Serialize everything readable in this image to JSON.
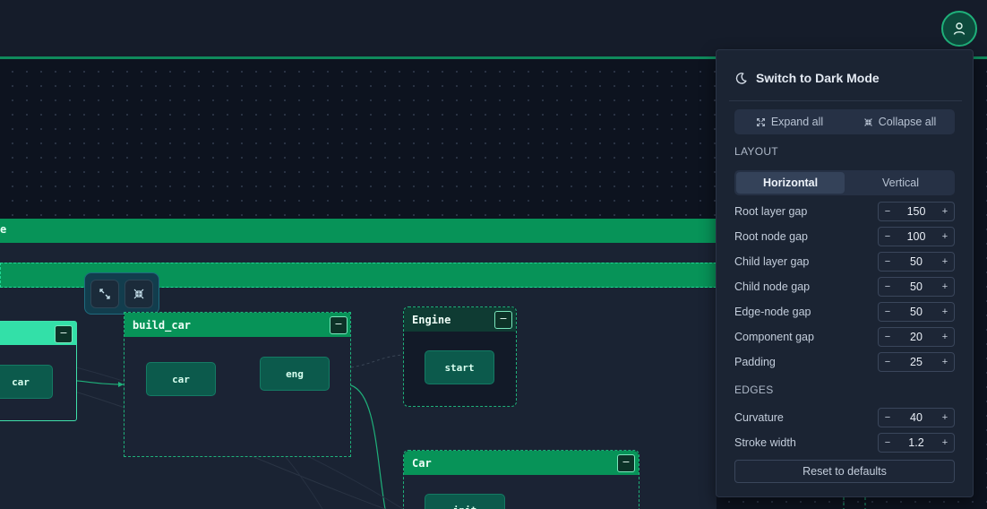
{
  "header": {
    "avatar_icon": "user-icon"
  },
  "canvas": {
    "outer_group_label": "e",
    "groups": {
      "left": {
        "node": "car"
      },
      "build_car": {
        "title": "build_car",
        "nodes": [
          "car",
          "eng"
        ]
      },
      "engine": {
        "title": "Engine",
        "nodes": [
          "start"
        ]
      },
      "car_group": {
        "title": "Car",
        "nodes": [
          "init"
        ]
      }
    },
    "collapse_label": "−",
    "controls": {
      "expand_icon": "expand-icon",
      "collapse_icon": "collapse-icon"
    }
  },
  "panel": {
    "theme_toggle": "Switch to Dark Mode",
    "expand_all": "Expand all",
    "collapse_all": "Collapse all",
    "layout_label": "LAYOUT",
    "orientation": {
      "horizontal": "Horizontal",
      "vertical": "Vertical",
      "selected": "Horizontal"
    },
    "layout_settings": [
      {
        "label": "Root layer gap",
        "value": "150"
      },
      {
        "label": "Root node gap",
        "value": "100"
      },
      {
        "label": "Child layer gap",
        "value": "50"
      },
      {
        "label": "Child node gap",
        "value": "50"
      },
      {
        "label": "Edge-node gap",
        "value": "50"
      },
      {
        "label": "Component gap",
        "value": "20"
      },
      {
        "label": "Padding",
        "value": "25"
      }
    ],
    "edges_label": "EDGES",
    "edge_settings": [
      {
        "label": "Curvature",
        "value": "40"
      },
      {
        "label": "Stroke width",
        "value": "1.2"
      }
    ],
    "minus": "−",
    "plus": "+",
    "reset": "Reset to defaults"
  },
  "colors": {
    "accent": "#079358",
    "panel_bg": "#1b2433",
    "canvas_bg": "#0d131f"
  }
}
